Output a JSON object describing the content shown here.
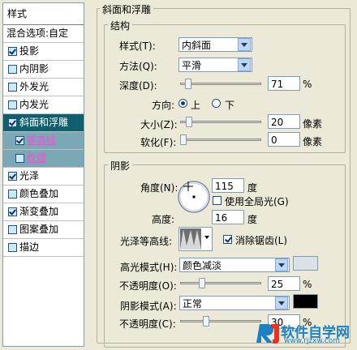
{
  "styles_panel": {
    "header": "样式",
    "blend_options": "混合选项:自定",
    "items": [
      {
        "label": "投影",
        "checked": true,
        "state": "normal"
      },
      {
        "label": "内阴影",
        "checked": false,
        "state": "normal"
      },
      {
        "label": "外发光",
        "checked": false,
        "state": "normal"
      },
      {
        "label": "内发光",
        "checked": false,
        "state": "normal"
      },
      {
        "label": "斜面和浮雕",
        "checked": true,
        "state": "selected"
      },
      {
        "label": "等高线",
        "checked": true,
        "state": "sub"
      },
      {
        "label": "纹理",
        "checked": false,
        "state": "sub"
      },
      {
        "label": "光泽",
        "checked": true,
        "state": "normal"
      },
      {
        "label": "颜色叠加",
        "checked": false,
        "state": "normal"
      },
      {
        "label": "渐变叠加",
        "checked": true,
        "state": "normal"
      },
      {
        "label": "图案叠加",
        "checked": false,
        "state": "normal"
      },
      {
        "label": "描边",
        "checked": false,
        "state": "normal"
      }
    ]
  },
  "bevel": {
    "title": "斜面和浮雕",
    "structure": {
      "title": "结构",
      "style_label": "样式(T):",
      "style_value": "内斜面",
      "technique_label": "方法(Q):",
      "technique_value": "平滑",
      "depth_label": "深度(D):",
      "depth_value": "71",
      "depth_unit": "%",
      "depth_fraction": 0.07,
      "direction_label": "方向:",
      "dir_up": "上",
      "dir_down": "下",
      "dir_selected": "上",
      "size_label": "大小(Z):",
      "size_value": "20",
      "size_unit": "像素",
      "size_fraction": 0.08,
      "soften_label": "软化(F):",
      "soften_value": "0",
      "soften_unit": "像素",
      "soften_fraction": 0.0
    },
    "shading": {
      "title": "阴影",
      "angle_label": "角度(N):",
      "angle_value": "115",
      "angle_unit": "度",
      "global_light_label": "使用全局光(G)",
      "global_light_checked": false,
      "altitude_label": "高度:",
      "altitude_value": "16",
      "altitude_unit": "度",
      "gloss_label": "光泽等高线:",
      "antialias_label": "消除锯齿(L)",
      "antialias_checked": true,
      "highlight_mode_label": "高光模式(H):",
      "highlight_mode_value": "颜色减淡",
      "highlight_color": "#d9e3e3",
      "highlight_opacity_label": "不透明度(O):",
      "highlight_opacity_value": "25",
      "highlight_opacity_unit": "%",
      "highlight_opacity_fraction": 0.25,
      "shadow_mode_label": "阴影模式(A):",
      "shadow_mode_value": "正常",
      "shadow_color": "#000000",
      "shadow_opacity_label": "不透明度(C):",
      "shadow_opacity_value": "30",
      "shadow_opacity_unit": "%",
      "shadow_opacity_fraction": 0.3
    }
  },
  "watermark": {
    "brand": "软件自学网",
    "url": "www.rjzxw.com"
  },
  "colors": {
    "selected_row": "#0f5f6d",
    "sub_row": "#7aa8b4",
    "sub_text": "#ff4ad8"
  }
}
